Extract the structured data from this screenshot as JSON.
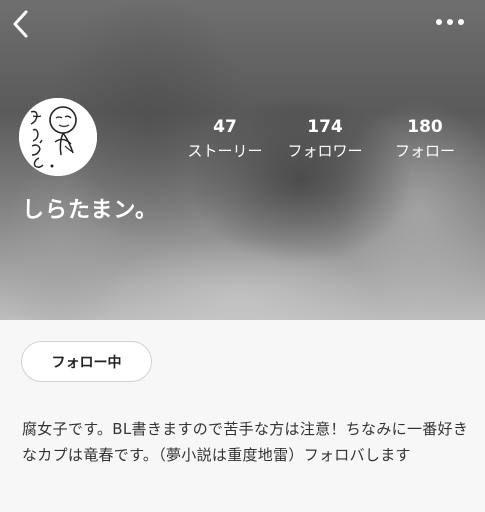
{
  "profile": {
    "username": "しらたまン。",
    "bio": "腐女子です。BL書きますので苦手な方は注意！ちなみに一番好きなカプは竜春です。（夢小説は重度地雷）フォロバします",
    "follow_button_label": "フォロー中"
  },
  "stats": {
    "stories": {
      "count": "47",
      "label": "ストーリー"
    },
    "followers": {
      "count": "174",
      "label": "フォロワー"
    },
    "following": {
      "count": "180",
      "label": "フォロー"
    }
  },
  "icons": {
    "back": "back-chevron-icon",
    "more": "more-dots-icon"
  },
  "colors": {
    "header_text": "#ffffff",
    "page_background": "#f7f7f7",
    "follow_button_border": "#d2d2d2"
  }
}
